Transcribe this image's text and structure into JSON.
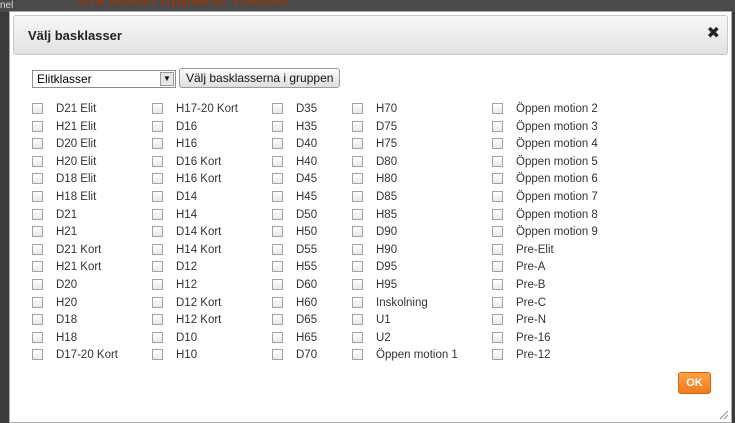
{
  "background": {
    "page_title": "Dra Model Uppland: Klasser",
    "side_text": "nel"
  },
  "dialog": {
    "title": "Välj basklasser",
    "close_symbol": "✖",
    "select": {
      "value": "Elitklasser",
      "arrow_symbol": "▼"
    },
    "group_button": "Välj basklasserna i gruppen",
    "columns": [
      [
        "D21 Elit",
        "H21 Elit",
        "D20 Elit",
        "H20 Elit",
        "D18 Elit",
        "H18 Elit",
        "D21",
        "H21",
        "D21 Kort",
        "H21 Kort",
        "D20",
        "H20",
        "D18",
        "H18",
        "D17-20 Kort"
      ],
      [
        "H17-20 Kort",
        "D16",
        "H16",
        "D16 Kort",
        "H16 Kort",
        "D14",
        "H14",
        "D14 Kort",
        "H14 Kort",
        "D12",
        "H12",
        "D12 Kort",
        "H12 Kort",
        "D10",
        "H10"
      ],
      [
        "D35",
        "H35",
        "D40",
        "H40",
        "D45",
        "H45",
        "D50",
        "H50",
        "D55",
        "H55",
        "D60",
        "H60",
        "D65",
        "H65",
        "D70"
      ],
      [
        "H70",
        "D75",
        "H75",
        "D80",
        "H80",
        "D85",
        "H85",
        "D90",
        "H90",
        "D95",
        "H95",
        "Inskolning",
        "U1",
        "U2",
        "Öppen motion 1"
      ],
      [
        "Öppen motion 2",
        "Öppen motion 3",
        "Öppen motion 4",
        "Öppen motion 5",
        "Öppen motion 6",
        "Öppen motion 7",
        "Öppen motion 8",
        "Öppen motion 9",
        "Pre-Elit",
        "Pre-A",
        "Pre-B",
        "Pre-C",
        "Pre-N",
        "Pre-16",
        "Pre-12"
      ]
    ],
    "ok_label": "OK"
  },
  "colors": {
    "ok_button": "#f58a2a",
    "title_bar": "#e8e8e8"
  }
}
